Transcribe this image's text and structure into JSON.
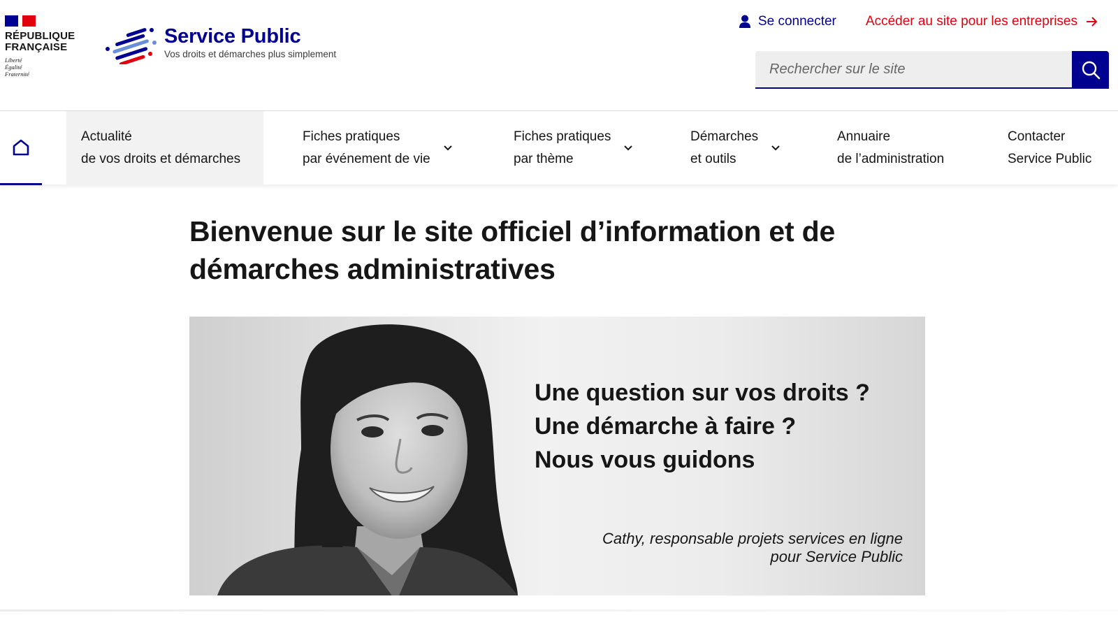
{
  "colors": {
    "brand_blue": "#000091",
    "marianne_red": "#e1000f",
    "text": "#161616",
    "nav_active_bg": "#f2f2f2"
  },
  "header": {
    "republic_name_line1": "RÉPUBLIQUE",
    "republic_name_line2": "FRANÇAISE",
    "motto": [
      "Liberté",
      "Égalité",
      "Fraternité"
    ],
    "site_title": "Service Public",
    "site_tagline": "Vos droits et démarches plus simplement",
    "login": {
      "label": "Se connecter",
      "icon": "user-icon"
    },
    "enterprise_link": {
      "label": "Accéder au site pour les entreprises",
      "icon": "arrow-right-icon"
    },
    "search": {
      "placeholder": "Rechercher sur le site",
      "value": "",
      "icon": "search-icon"
    }
  },
  "nav": {
    "home_icon": "home-icon",
    "items": [
      {
        "line1": "Actualité",
        "line2": "de vos droits et démarches",
        "has_dropdown": false,
        "active": true
      },
      {
        "line1": "Fiches pratiques",
        "line2": "par événement de vie",
        "has_dropdown": true
      },
      {
        "line1": "Fiches pratiques",
        "line2": "par thème",
        "has_dropdown": true
      },
      {
        "line1": "Démarches",
        "line2": "et outils",
        "has_dropdown": true
      },
      {
        "line1": "Annuaire",
        "line2": "de l’administration",
        "has_dropdown": false
      },
      {
        "line1": "Contacter",
        "line2": "Service Public",
        "has_dropdown": false
      }
    ]
  },
  "main": {
    "title_line1": "Bienvenue sur le site officiel d’information et de",
    "title_line2": "démarches administratives",
    "hero": {
      "lines": [
        "Une question sur vos droits ?",
        "Une démarche à faire ?",
        "Nous vous guidons"
      ],
      "caption_line1": "Cathy, responsable projets services en ligne",
      "caption_line2": "pour Service Public"
    }
  }
}
